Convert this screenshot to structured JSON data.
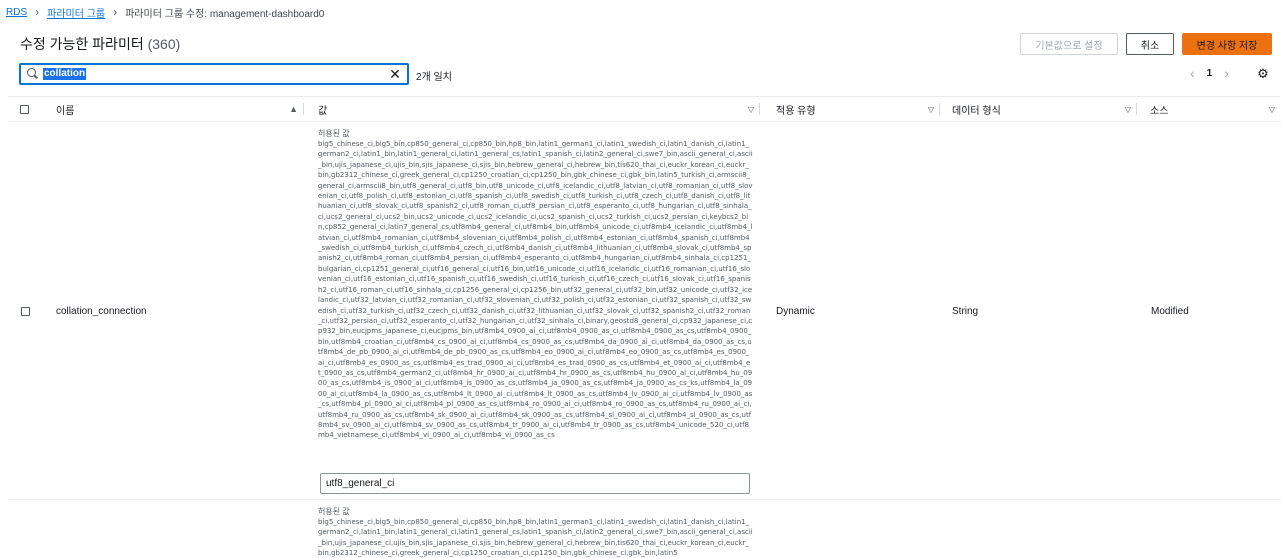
{
  "breadcrumb": {
    "items": [
      {
        "label": "RDS"
      },
      {
        "label": "파라미터 그룹"
      }
    ],
    "current": "파라미터 그룹 수정: management-dashboard0"
  },
  "header": {
    "title": "수정 가능한 파라미터",
    "count": "(360)"
  },
  "actions": {
    "reset": "기본값으로 설정",
    "cancel": "취소",
    "save": "변경 사항 저장"
  },
  "search": {
    "value": "collation",
    "match_text": "2개 일치"
  },
  "pagination": {
    "page": "1"
  },
  "table": {
    "columns": [
      {
        "label": "이름"
      },
      {
        "label": "값"
      },
      {
        "label": "적용 유형"
      },
      {
        "label": "데이터 형식"
      },
      {
        "label": "소스"
      }
    ],
    "rows": [
      {
        "allowed_label": "허용된 값",
        "allowed_values": "big5_chinese_ci,big5_bin,cp850_general_ci,cp850_bin,hp8_bin,latin1_german1_ci,latin1_swedish_ci,latin1_danish_ci,latin1_german2_ci,latin1_bin,latin1_general_ci,latin1_general_cs,latin1_spanish_ci,latin2_general_ci,swe7_bin,ascii_general_ci,ascii_bin,ujis_japanese_ci,ujis_bin,sjis_japanese_ci,sjis_bin,hebrew_general_ci,hebrew_bin,tis620_thai_ci,euckr_korean_ci,euckr_bin,gb2312_chinese_ci,greek_general_ci,cp1250_croatian_ci,cp1250_bin,gbk_chinese_ci,gbk_bin,latin5_turkish_ci,armscii8_general_ci,armscii8_bin,utf8_general_ci,utf8_bin,utf8_unicode_ci,utf8_icelandic_ci,utf8_latvian_ci,utf8_romanian_ci,utf8_slovenian_ci,utf8_polish_ci,utf8_estonian_ci,utf8_spanish_ci,utf8_swedish_ci,utf8_turkish_ci,utf8_czech_ci,utf8_danish_ci,utf8_lithuanian_ci,utf8_slovak_ci,utf8_spanish2_ci,utf8_roman_ci,utf8_persian_ci,utf8_esperanto_ci,utf8_hungarian_ci,utf8_sinhala_ci,ucs2_general_ci,ucs2_bin,ucs2_unicode_ci,ucs2_icelandic_ci,ucs2_spanish_ci,ucs2_turkish_ci,ucs2_persian_ci,keybcs2_bin,cp852_general_ci,latin7_general_cs,utf8mb4_general_ci,utf8mb4_bin,utf8mb4_unicode_ci,utf8mb4_icelandic_ci,utf8mb4_latvian_ci,utf8mb4_romanian_ci,utf8mb4_slovenian_ci,utf8mb4_polish_ci,utf8mb4_estonian_ci,utf8mb4_spanish_ci,utf8mb4_swedish_ci,utf8mb4_turkish_ci,utf8mb4_czech_ci,utf8mb4_danish_ci,utf8mb4_lithuanian_ci,utf8mb4_slovak_ci,utf8mb4_spanish2_ci,utf8mb4_roman_ci,utf8mb4_persian_ci,utf8mb4_esperanto_ci,utf8mb4_hungarian_ci,utf8mb4_sinhala_ci,cp1251_bulgarian_ci,cp1251_general_ci,utf16_general_ci,utf16_bin,utf16_unicode_ci,utf16_icelandic_ci,utf16_romanian_ci,utf16_slovenian_ci,utf16_estonian_ci,utf16_spanish_ci,utf16_swedish_ci,utf16_turkish_ci,utf16_czech_ci,utf16_slovak_ci,utf16_spanish2_ci,utf16_roman_ci,utf16_sinhala_ci,cp1256_general_ci,cp1256_bin,utf32_general_ci,utf32_bin,utf32_unicode_ci,utf32_icelandic_ci,utf32_latvian_ci,utf32_romanian_ci,utf32_slovenian_ci,utf32_polish_ci,utf32_estonian_ci,utf32_spanish_ci,utf32_swedish_ci,utf32_turkish_ci,utf32_czech_ci,utf32_danish_ci,utf32_lithuanian_ci,utf32_slovak_ci,utf32_spanish2_ci,utf32_roman_ci,utf32_persian_ci,utf32_esperanto_ci,utf32_hungarian_ci,utf32_sinhala_ci,binary,geostd8_general_ci,cp932_japanese_ci,cp932_bin,eucjpms_japanese_ci,eucjpms_bin,utf8mb4_0900_ai_ci,utf8mb4_0900_as_ci,utf8mb4_0900_as_cs,utf8mb4_0900_bin,utf8mb4_croatian_ci,utf8mb4_cs_0900_ai_ci,utf8mb4_cs_0900_as_cs,utf8mb4_da_0900_ai_ci,utf8mb4_da_0900_as_cs,utf8mb4_de_pb_0900_ai_ci,utf8mb4_de_pb_0900_as_cs,utf8mb4_eo_0900_ai_ci,utf8mb4_eo_0900_as_cs,utf8mb4_es_0900_ai_ci,utf8mb4_es_0900_as_cs,utf8mb4_es_trad_0900_ai_ci,utf8mb4_es_trad_0900_as_cs,utf8mb4_et_0900_ai_ci,utf8mb4_et_0900_as_cs,utf8mb4_german2_ci,utf8mb4_hr_0900_ai_ci,utf8mb4_hr_0900_as_cs,utf8mb4_hu_0900_ai_ci,utf8mb4_hu_0900_as_cs,utf8mb4_is_0900_ai_ci,utf8mb4_is_0900_as_cs,utf8mb4_ja_0900_as_cs,utf8mb4_ja_0900_as_cs_ks,utf8mb4_la_0900_ai_ci,utf8mb4_la_0900_as_cs,utf8mb4_lt_0900_ai_ci,utf8mb4_lt_0900_as_cs,utf8mb4_lv_0900_ai_ci,utf8mb4_lv_0900_as_cs,utf8mb4_pl_0900_ai_ci,utf8mb4_pl_0900_as_cs,utf8mb4_ro_0900_ai_ci,utf8mb4_ro_0900_as_cs,utf8mb4_ru_0900_ai_ci,utf8mb4_ru_0900_as_cs,utf8mb4_sk_0900_ai_ci,utf8mb4_sk_0900_as_cs,utf8mb4_sl_0900_ai_ci,utf8mb4_sl_0900_as_cs,utf8mb4_sv_0900_ai_ci,utf8mb4_sv_0900_as_cs,utf8mb4_tr_0900_ai_ci,utf8mb4_tr_0900_as_cs,utf8mb4_unicode_520_ci,utf8mb4_vietnamese_ci,utf8mb4_vi_0900_ai_ci,utf8mb4_vi_0900_as_cs",
        "name": "collation_connection",
        "value": "utf8_general_ci",
        "apply_type": "Dynamic",
        "data_type": "String",
        "source": "Modified"
      },
      {
        "allowed_label": "허용된 값",
        "allowed_values": "big5_chinese_ci,big5_bin,cp850_general_ci,cp850_bin,hp8_bin,latin1_german1_ci,latin1_swedish_ci,latin1_danish_ci,latin1_german2_ci,latin1_bin,latin1_general_ci,latin1_general_cs,latin1_spanish_ci,latin2_general_ci,swe7_bin,ascii_general_ci,ascii_bin,ujis_japanese_ci,ujis_bin,sjis_japanese_ci,sjis_bin,hebrew_general_ci,hebrew_bin,tis620_thai_ci,euckr_korean_ci,euckr_bin,gb2312_chinese_ci,greek_general_ci,cp1250_croatian_ci,cp1250_bin,gbk_chinese_ci,gbk_bin,latin5"
      }
    ]
  }
}
